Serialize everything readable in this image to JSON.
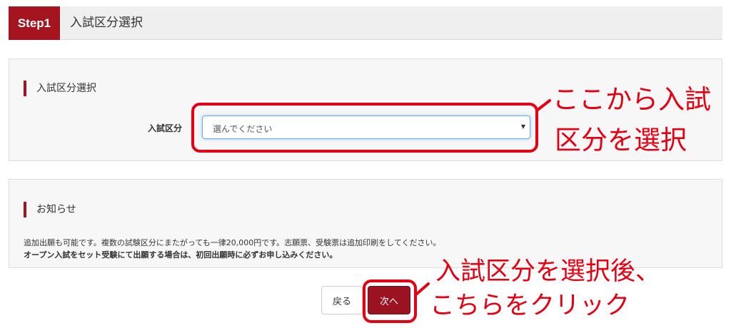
{
  "step": {
    "badge": "Step1",
    "title": "入試区分選択"
  },
  "selection_panel": {
    "heading": "入試区分選択",
    "field_label": "入試区分",
    "select_value": "選んでください",
    "select_caret": "▼"
  },
  "notice_panel": {
    "heading": "お知らせ",
    "line1": "追加出願も可能です。複数の試験区分にまたがっても一律20,000円です。志願票、受験票は追加印刷をしてください。",
    "line2": "オープン入試をセット受験にて出願する場合は、初回出願時に必ずお申し込みください。"
  },
  "buttons": {
    "back": "戻る",
    "next": "次へ"
  },
  "annotations": {
    "select_line1": "ここから入試",
    "select_line2": "区分を選択",
    "next_line1": "入試区分を選択後、",
    "next_line2": "こちらをクリック",
    "color": "#e60012"
  },
  "colors": {
    "brand": "#a4151f",
    "focus": "#66afe9"
  }
}
